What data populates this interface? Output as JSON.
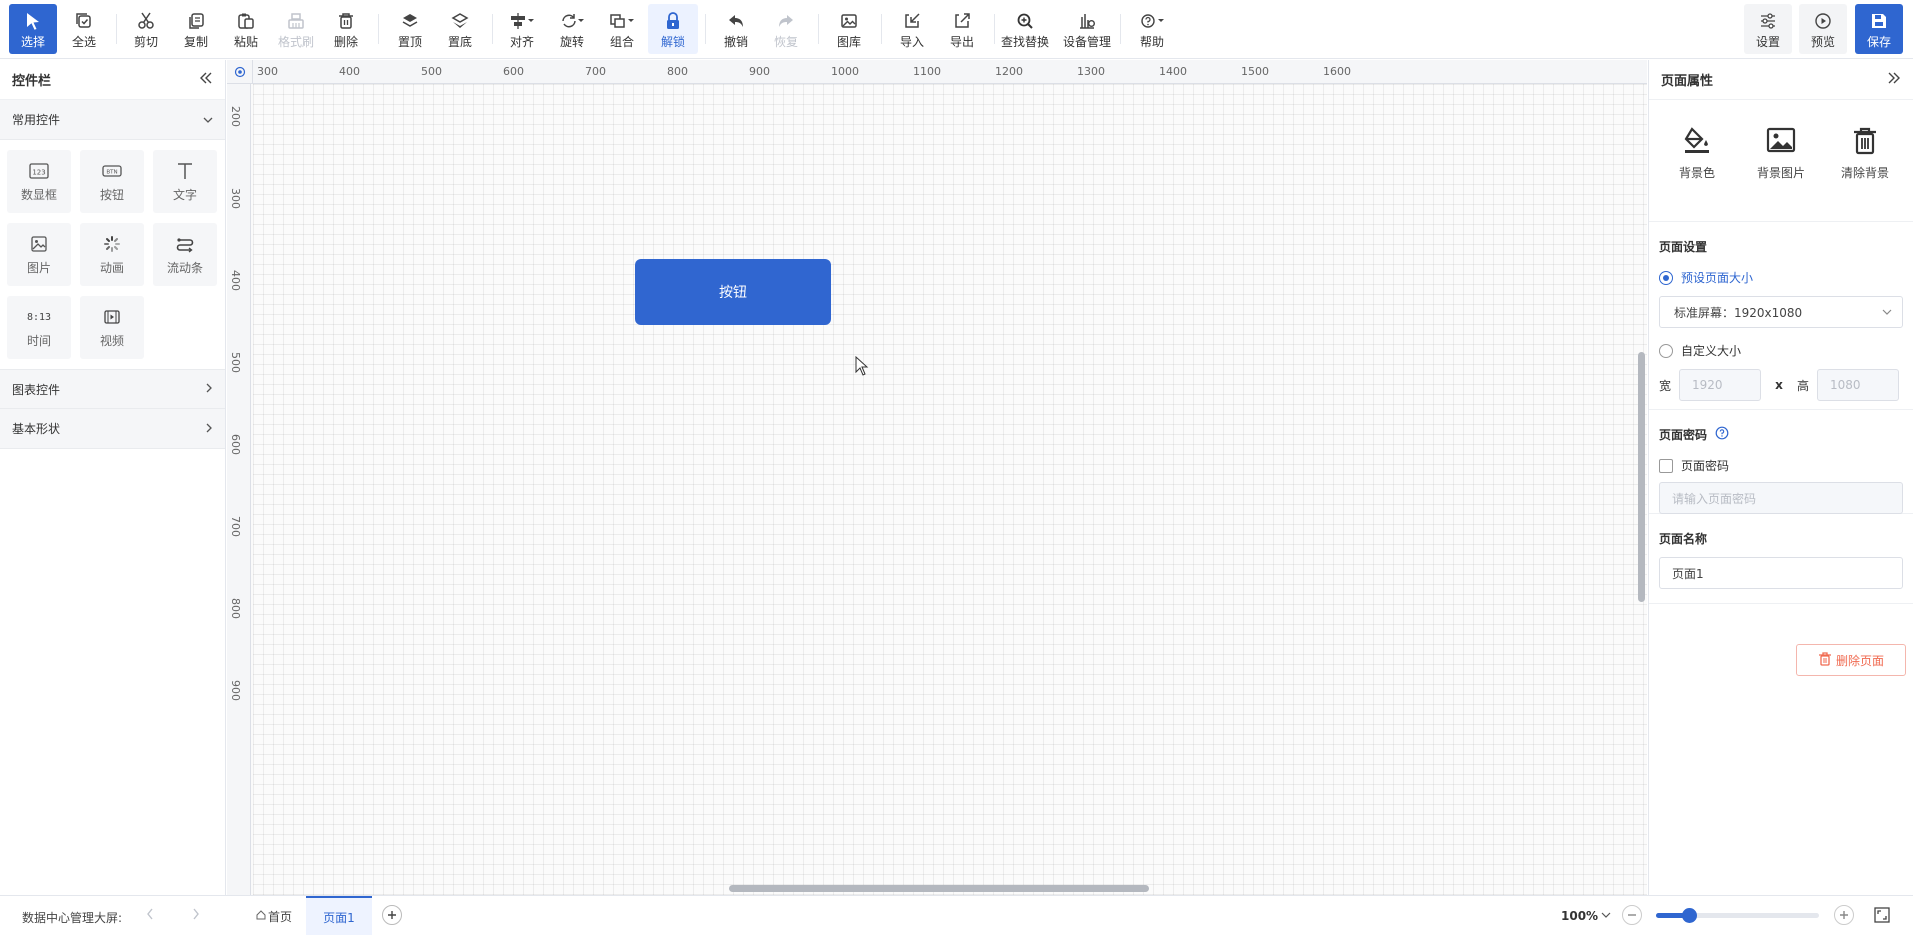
{
  "toolbar": {
    "select": "选择",
    "select_all": "全选",
    "cut": "剪切",
    "copy": "复制",
    "paste": "粘贴",
    "format_brush": "格式刷",
    "delete": "删除",
    "bring_top": "置顶",
    "send_bottom": "置底",
    "align": "对齐",
    "rotate": "旋转",
    "group": "组合",
    "unlock": "解锁",
    "undo": "撤销",
    "redo": "恢复",
    "gallery": "图库",
    "import": "导入",
    "export": "导出",
    "find_replace": "查找替换",
    "device_mgmt": "设备管理",
    "help": "帮助",
    "settings": "设置",
    "preview": "预览",
    "save": "保存"
  },
  "left_panel": {
    "title": "控件栏",
    "common_section": "常用控件",
    "widgets": [
      {
        "label": "数显框",
        "icon": "numeric-display-icon"
      },
      {
        "label": "按钮",
        "icon": "button-icon"
      },
      {
        "label": "文字",
        "icon": "text-icon"
      },
      {
        "label": "图片",
        "icon": "image-icon"
      },
      {
        "label": "动画",
        "icon": "animation-icon"
      },
      {
        "label": "流动条",
        "icon": "flow-bar-icon"
      },
      {
        "label": "时间",
        "icon": "time-icon"
      },
      {
        "label": "视频",
        "icon": "video-icon"
      }
    ],
    "chart_section": "图表控件",
    "shape_section": "基本形状",
    "numeric_icon_text": "123",
    "button_icon_text": "BTN",
    "time_icon_text": "8:13"
  },
  "canvas": {
    "h_ruler": [
      "300",
      "400",
      "500",
      "600",
      "700",
      "800",
      "900",
      "1000",
      "1100",
      "1200",
      "1300",
      "1400",
      "1500",
      "1600"
    ],
    "v_ruler": [
      "200",
      "300",
      "400",
      "500",
      "600",
      "700",
      "800",
      "900"
    ],
    "button_text": "按钮"
  },
  "right_panel": {
    "title": "页面属性",
    "bg_color": "背景色",
    "bg_image": "背景图片",
    "clear_bg": "清除背景",
    "page_settings": "页面设置",
    "preset_size": "预设页面大小",
    "preset_value": "标准屏幕：1920x1080",
    "custom_size": "自定义大小",
    "width_label": "宽",
    "width_value": "1920",
    "x_label": "x",
    "height_label": "高",
    "height_value": "1080",
    "password_title": "页面密码",
    "password_checkbox": "页面密码",
    "password_placeholder": "请输入页面密码",
    "page_name_title": "页面名称",
    "page_name_value": "页面1",
    "delete_page": "删除页面"
  },
  "bottom": {
    "project": "数据中心管理大屏:",
    "home_tab": "首页",
    "page_tab": "页面1",
    "zoom": "100%",
    "zoom_level": 0.2
  },
  "colors": {
    "accent": "#2f66d0",
    "danger": "#f06a50"
  }
}
